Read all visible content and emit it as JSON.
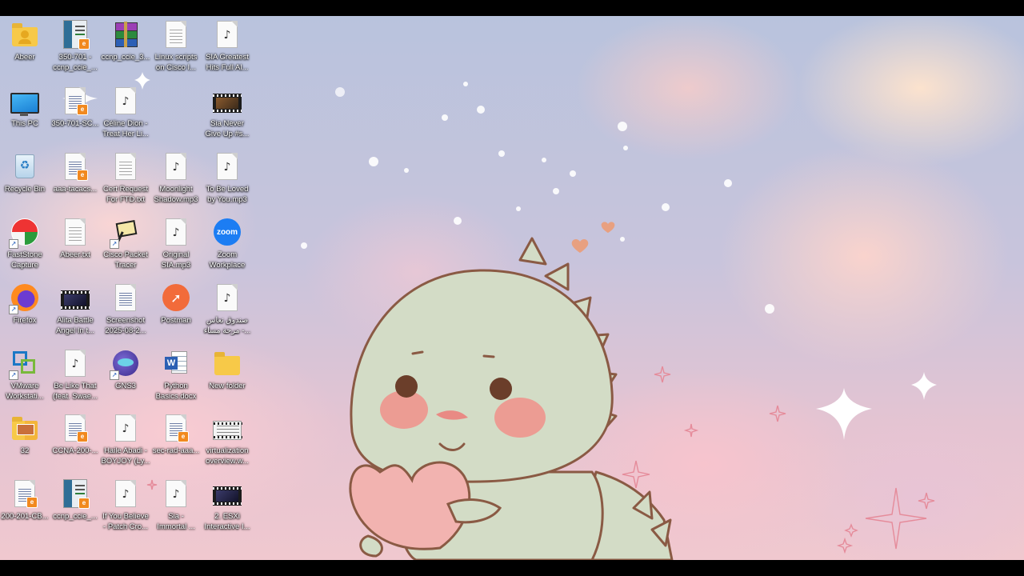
{
  "desktop": {
    "icons": [
      {
        "label": "Abeer",
        "type": "user-folder"
      },
      {
        "label": "350-701 -\nccnp_ccie_...",
        "type": "book-pdf"
      },
      {
        "label": "ccnp_ccie_3...",
        "type": "winrar"
      },
      {
        "label": "Linux scripts\non Cisco I...",
        "type": "document"
      },
      {
        "label": "SIA Greatest\nHits Full Al...",
        "type": "music"
      },
      {
        "label": "This PC",
        "type": "this-pc"
      },
      {
        "label": "350-701-SC...",
        "type": "document-pdf"
      },
      {
        "label": "Céline Dion -\nTreat Her Li...",
        "type": "music"
      },
      {
        "label": "Sia Never\nGive Up #s...",
        "type": "video"
      },
      {
        "label": "Recycle Bin",
        "type": "recycle-bin"
      },
      {
        "label": "aaa-tacacs...",
        "type": "document-pdf"
      },
      {
        "label": "Cert Request\nFor FTD.txt",
        "type": "document"
      },
      {
        "label": "Moonlight\nShadow.mp3",
        "type": "music"
      },
      {
        "label": "To Be Loved\nby You.mp3",
        "type": "music"
      },
      {
        "label": "FastStone\nCapture",
        "type": "faststone"
      },
      {
        "label": "Abeer.txt",
        "type": "document"
      },
      {
        "label": "Cisco Packet\nTracer",
        "type": "packet-tracer"
      },
      {
        "label": "Original\nSIA.mp3",
        "type": "music"
      },
      {
        "label": "Zoom\nWorkplace",
        "type": "zoom"
      },
      {
        "label": "Firefox",
        "type": "firefox"
      },
      {
        "label": "Alita Battle\nAngel In t...",
        "type": "video-dark"
      },
      {
        "label": "Screenshot\n2025-08-2...",
        "type": "image"
      },
      {
        "label": "Postman",
        "type": "postman"
      },
      {
        "label": "صندوق نعاس\nمرحة مساء -...",
        "type": "music"
      },
      {
        "label": "VMware\nWorkstati...",
        "type": "vmware"
      },
      {
        "label": "Be Like That\n(feat. Swae...",
        "type": "music"
      },
      {
        "label": "GNS3",
        "type": "gns3"
      },
      {
        "label": "Python\nBasics.docx",
        "type": "word"
      },
      {
        "label": "New folder",
        "type": "folder"
      },
      {
        "label": "32",
        "type": "folder-thumbs"
      },
      {
        "label": "CCNA-200-...",
        "type": "document-pdf"
      },
      {
        "label": "Haile Abadi -\nBOYJOY (Ly...",
        "type": "music"
      },
      {
        "label": "sec-rad-aaa...",
        "type": "document-pdf"
      },
      {
        "label": "virtualization\noverview.w...",
        "type": "video-white"
      },
      {
        "label": "200-201-CB...",
        "type": "document-pdf"
      },
      {
        "label": "ccnp_ccie_...",
        "type": "book-pdf"
      },
      {
        "label": "If You Believe\n- Patch Cro...",
        "type": "music"
      },
      {
        "label": "Sia -\nImmortal ...",
        "type": "music"
      },
      {
        "label": "2. ESXi\nInteractive I...",
        "type": "video-dark"
      }
    ]
  }
}
